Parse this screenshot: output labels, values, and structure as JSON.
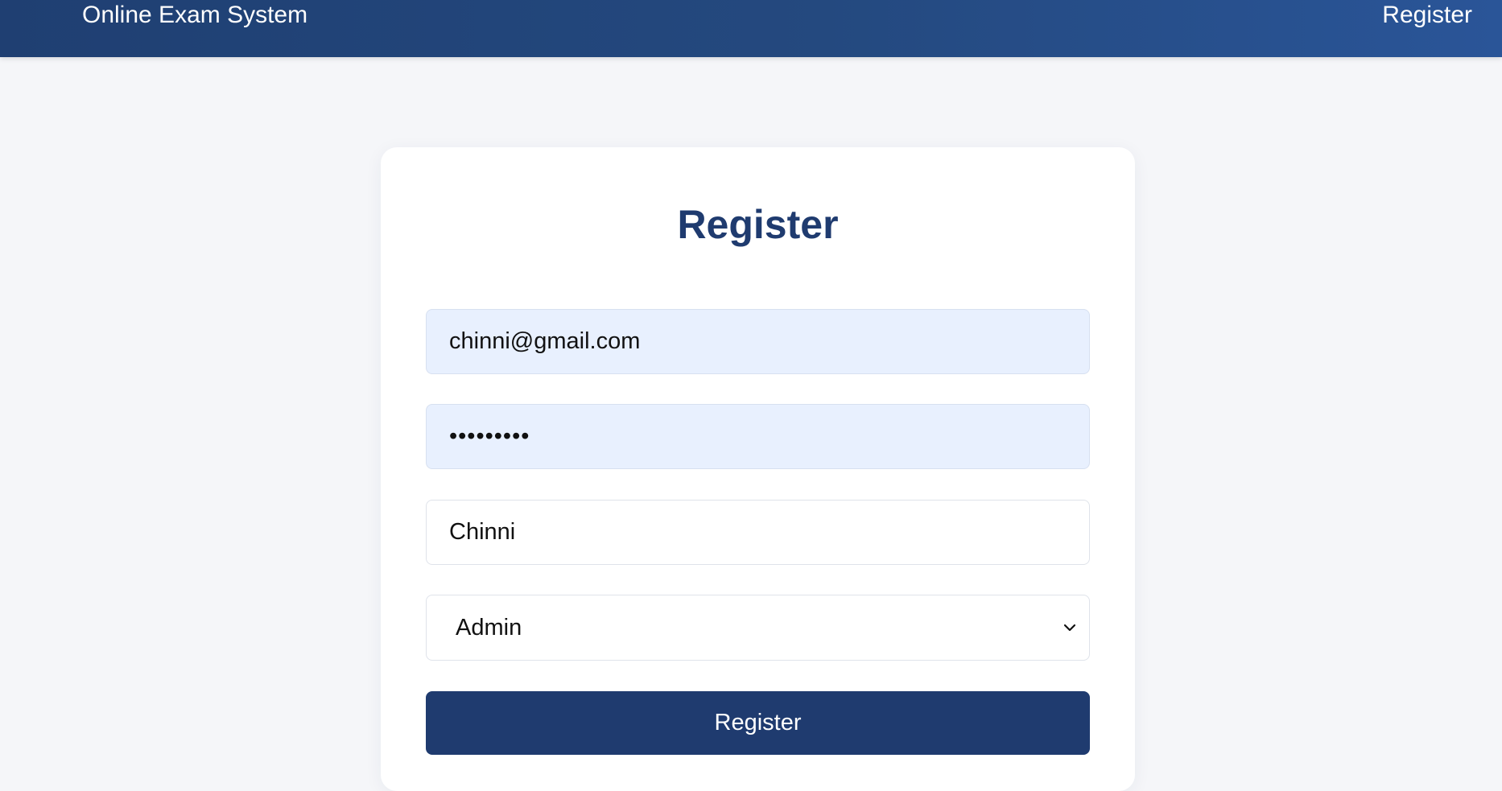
{
  "navbar": {
    "brand": "Online Exam System",
    "link": "Register"
  },
  "form": {
    "title": "Register",
    "email": {
      "value": "chinni@gmail.com"
    },
    "password": {
      "value": "•••••••••"
    },
    "name": {
      "value": "Chinni"
    },
    "role": {
      "selected": "Admin"
    },
    "submit_label": "Register"
  },
  "colors": {
    "navbar_start": "#1f3f72",
    "navbar_end": "#2a5598",
    "accent": "#1f3b6f",
    "autofill_bg": "#e8f0fe",
    "page_bg": "#f5f6f9"
  },
  "icons": {
    "select_arrow": "chevron-down-icon"
  }
}
